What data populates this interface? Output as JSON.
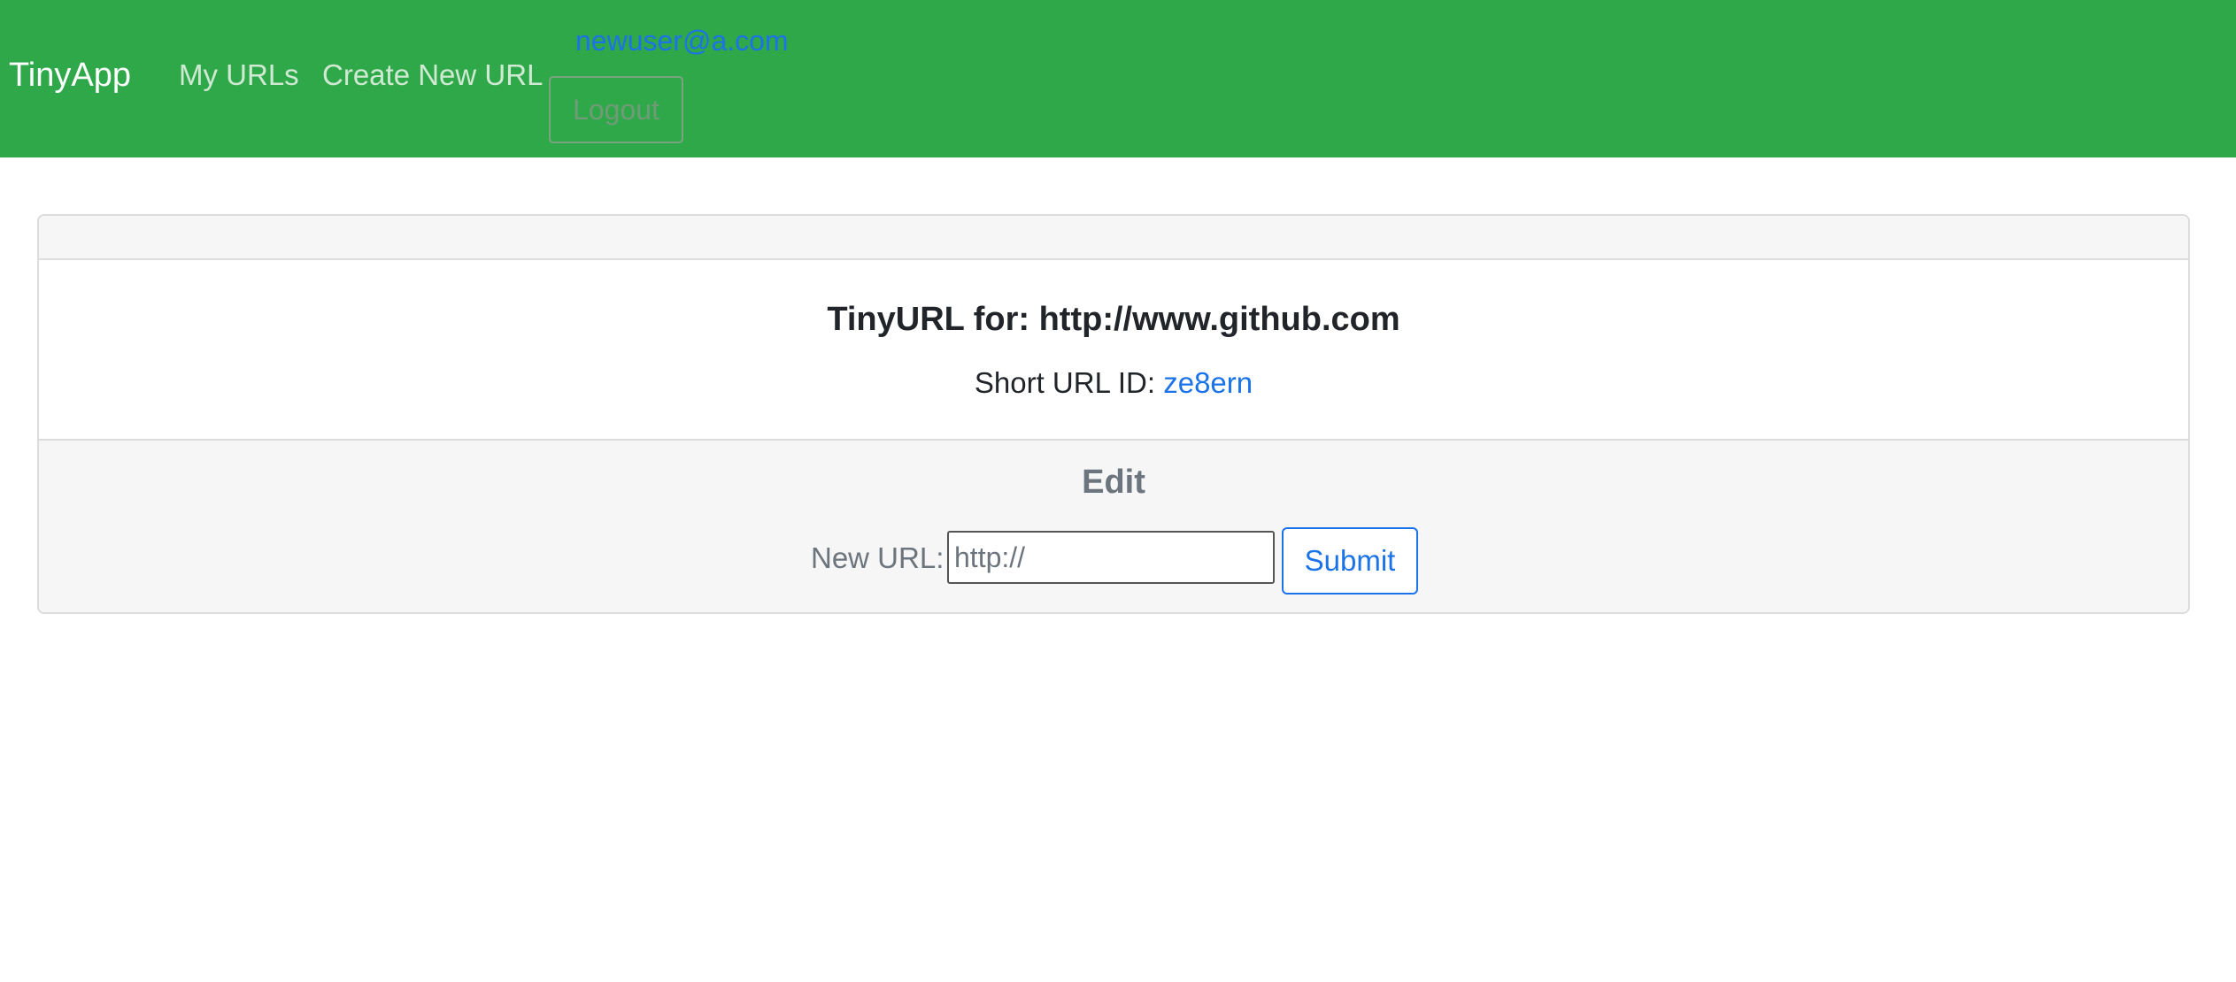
{
  "navbar": {
    "brand": "TinyApp",
    "links": [
      "My URLs",
      "Create New URL"
    ],
    "user_email": "newuser@a.com",
    "logout_label": "Logout",
    "background_color": "#2fa84a"
  },
  "card": {
    "title": "TinyURL for: http://www.github.com",
    "short_url_label": "Short URL ID:",
    "short_url_id": "ze8ern",
    "edit_heading": "Edit",
    "new_url_label": "New URL:",
    "new_url_placeholder": "http://",
    "new_url_value": "",
    "submit_label": "Submit",
    "link_color": "#1a73e8"
  }
}
